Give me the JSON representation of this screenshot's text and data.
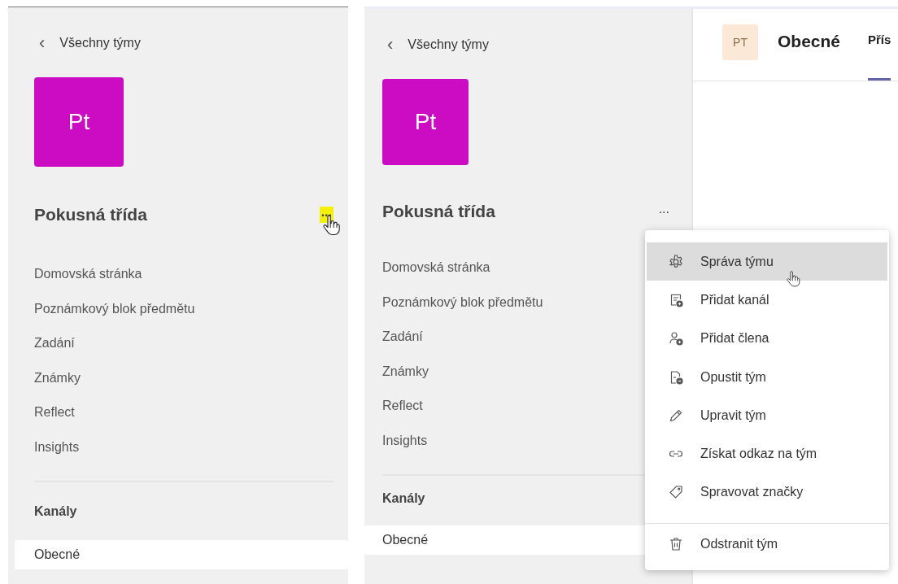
{
  "panels": [
    {
      "back": {
        "icon": "‹",
        "label": "Všechny týmy"
      },
      "avatar": "Pt",
      "team_name": "Pokusná třída",
      "more": {
        "label": "...",
        "highlighted": true
      },
      "nav": [
        "Domovská stránka",
        "Poznámkový blok předmětu",
        "Zadání",
        "Známky",
        "Reflect",
        "Insights"
      ],
      "channels_heading": "Kanály",
      "channels": [
        {
          "label": "Obecné",
          "selected": true
        }
      ]
    },
    {
      "back": {
        "icon": "‹",
        "label": "Všechny týmy"
      },
      "avatar": "Pt",
      "team_name": "Pokusná třída",
      "more": {
        "label": "...",
        "highlighted": false
      },
      "nav": [
        "Domovská stránka",
        "Poznámkový blok předmětu",
        "Zadání",
        "Známky",
        "Reflect",
        "Insights"
      ],
      "channels_heading": "Kanály",
      "channels": [
        {
          "label": "Obecné",
          "selected": true
        }
      ],
      "header": {
        "avatar": "PT",
        "title": "Obecné",
        "tab": {
          "label": "Přís",
          "selected": true
        }
      },
      "menu": {
        "items": [
          {
            "kind": "gear",
            "label": "Správa týmu",
            "selected": true
          },
          {
            "kind": "channel",
            "label": "Přidat kanál",
            "selected": false
          },
          {
            "kind": "member",
            "label": "Přidat člena",
            "selected": false
          },
          {
            "kind": "leave",
            "label": "Opustit tým",
            "selected": false
          },
          {
            "kind": "edit",
            "label": "Upravit tým",
            "selected": false
          },
          {
            "kind": "link",
            "label": "Získat odkaz na tým",
            "selected": false
          },
          {
            "kind": "tag",
            "label": "Spravovat značky",
            "selected": false
          },
          {
            "kind": "delete",
            "label": "Odstranit tým",
            "selected": false
          }
        ]
      }
    }
  ]
}
